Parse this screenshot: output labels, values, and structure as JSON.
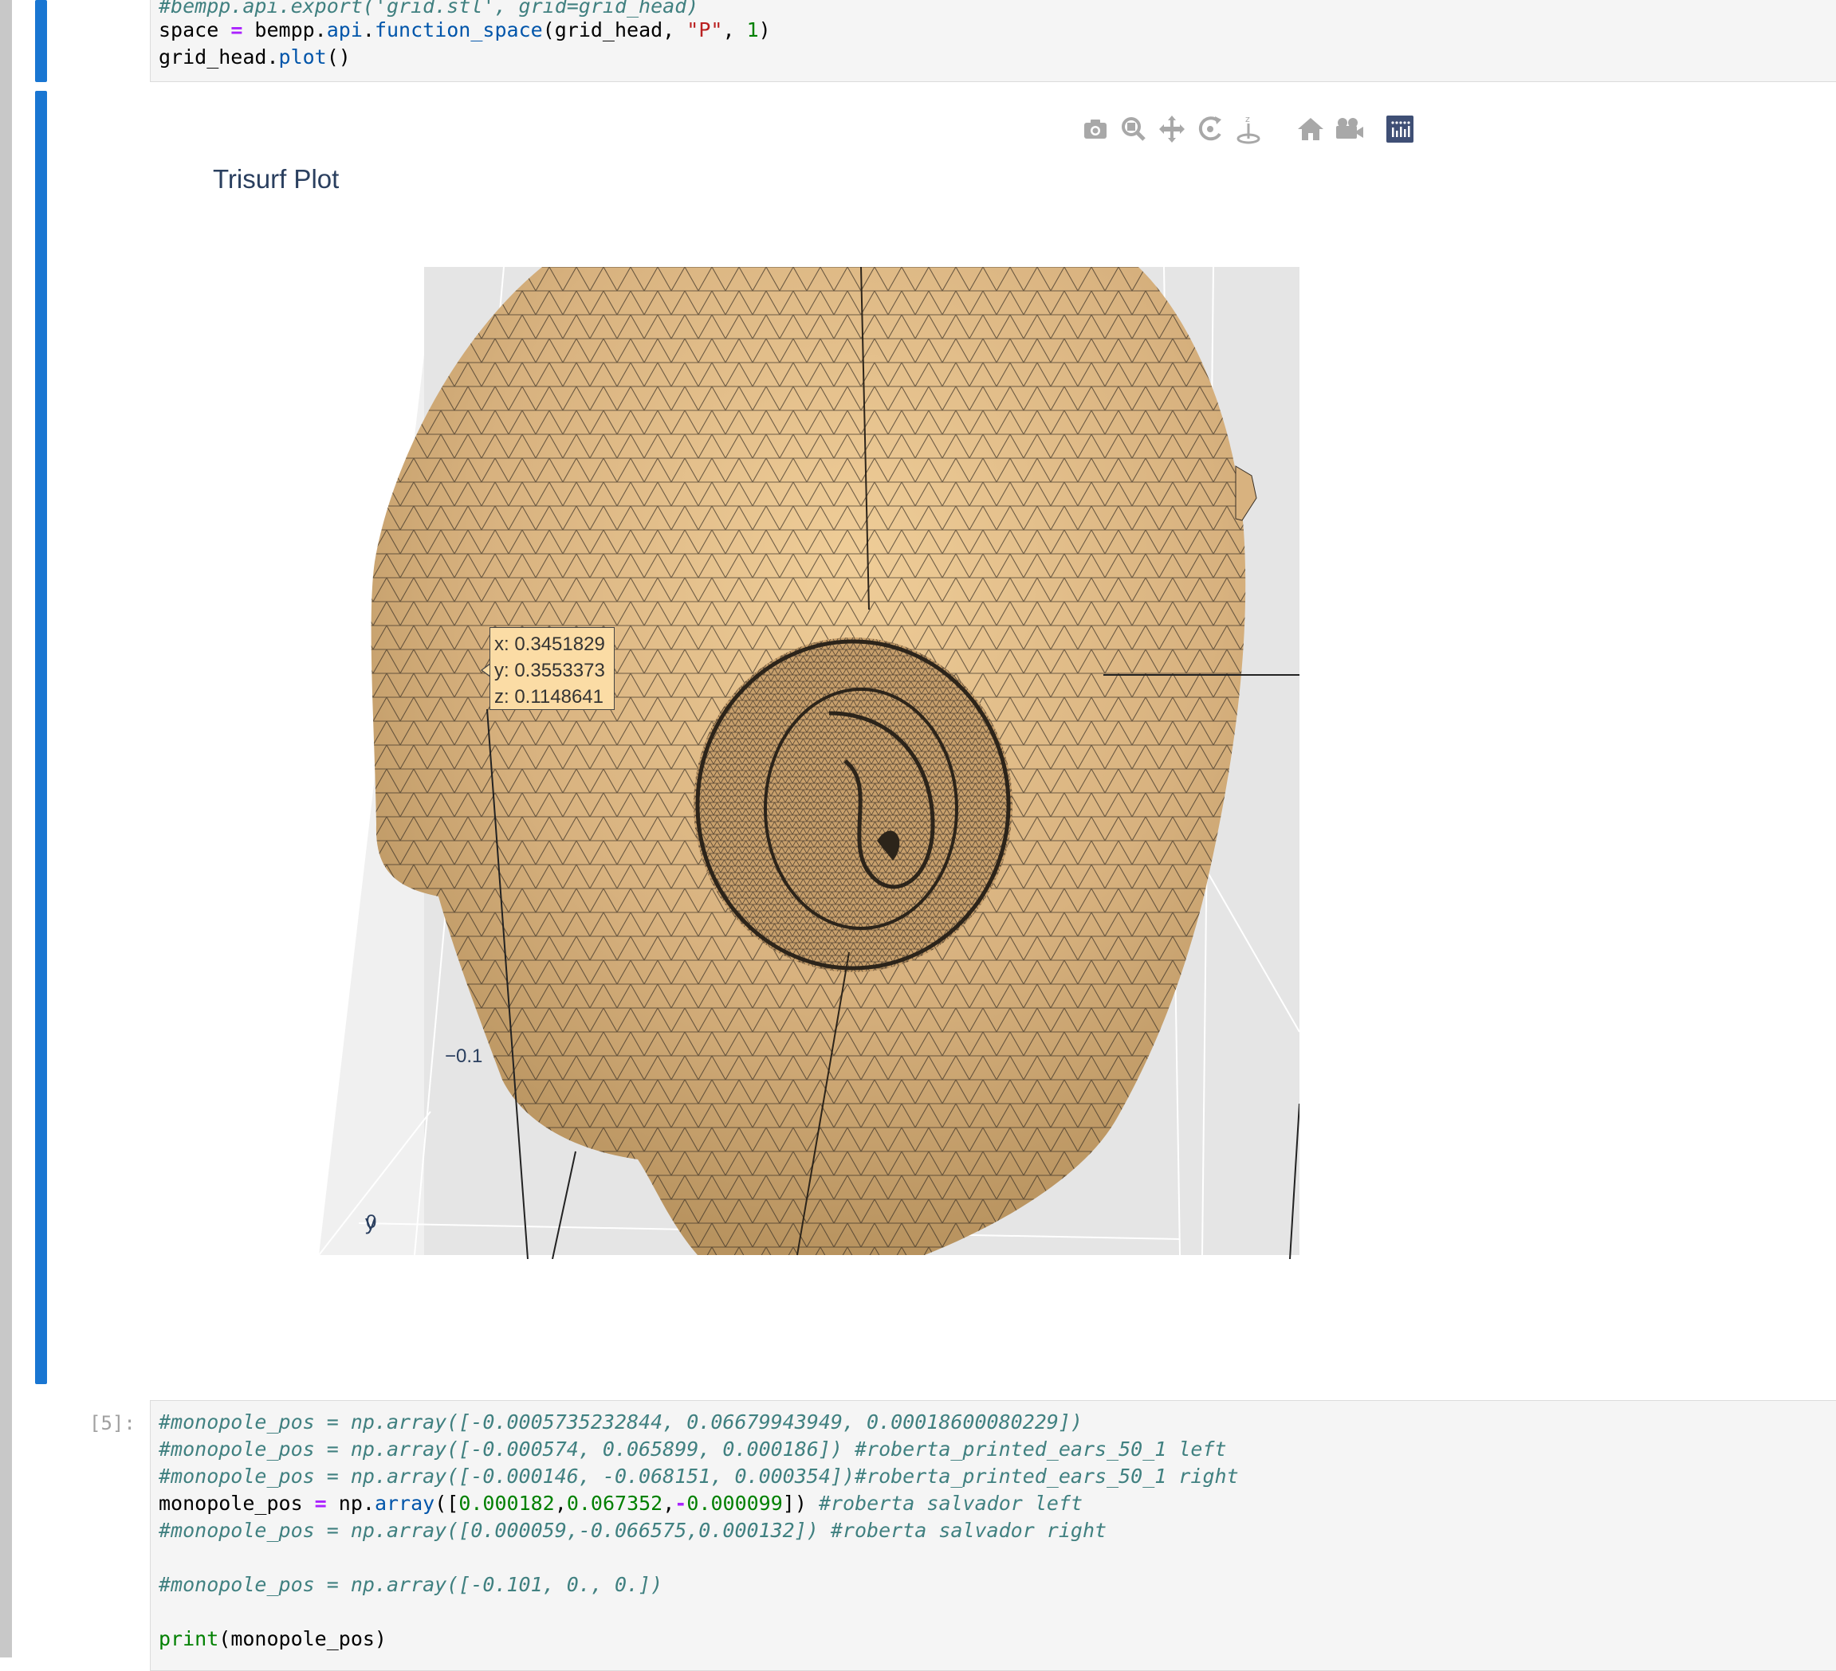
{
  "cell_top": {
    "line0": "#bempp.api.export('grid.stl', grid=grid_head)",
    "line1": {
      "a": "space ",
      "op": "=",
      "b": " bempp.",
      "api": "api",
      ".": ".",
      "fn": "function_space",
      "c": "(grid_head, ",
      "str": "\"P\"",
      "d": ", ",
      "num": "1",
      "e": ")"
    },
    "line2": {
      "a": "grid_head.",
      "fn": "plot",
      "b": "()"
    }
  },
  "plot": {
    "title": "Trisurf Plot",
    "hover": {
      "x": "x: 0.3451829",
      "y": "y: 0.3553373",
      "z": "z: 0.1148641"
    },
    "axis": {
      "y_title": "y",
      "y_tick_0": "0",
      "tick_neg": "−0.1"
    },
    "surface_color": "#d9b385",
    "modebar_icons": [
      "camera-icon",
      "zoom-icon",
      "pan-icon",
      "orbit-rotation-icon",
      "turntable-rotation-icon",
      "home-icon",
      "reset-camera-icon",
      "plotly-logo-icon"
    ]
  },
  "cell5": {
    "prompt": "[5]:",
    "l1": "#monopole_pos = np.array([-0.0005735232844, 0.06679943949, 0.00018600080229])",
    "l2": "#monopole_pos = np.array([-0.000574, 0.065899, 0.000186]) #roberta_printed_ears_50_1 left",
    "l3": "#monopole_pos = np.array([-0.000146, -0.068151, 0.000354])#roberta_printed_ears_50_1 right",
    "l4": {
      "a": "monopole_pos ",
      "op": "=",
      "b": " np.",
      "fn": "array",
      "c": "([",
      "n1": "0.000182",
      ",": ",",
      "n2": "0.067352",
      "c2": ",",
      "op2": "-",
      "n3": "0.000099",
      "d": "]) ",
      "cm": "#roberta salvador left"
    },
    "l5": "#monopole_pos = np.array([0.000059,-0.066575,0.000132]) #roberta salvador right",
    "l6": "#monopole_pos = np.array([-0.101, 0., 0.])",
    "l7": {
      "fn": "print",
      "b": "(monopole_pos)"
    }
  }
}
